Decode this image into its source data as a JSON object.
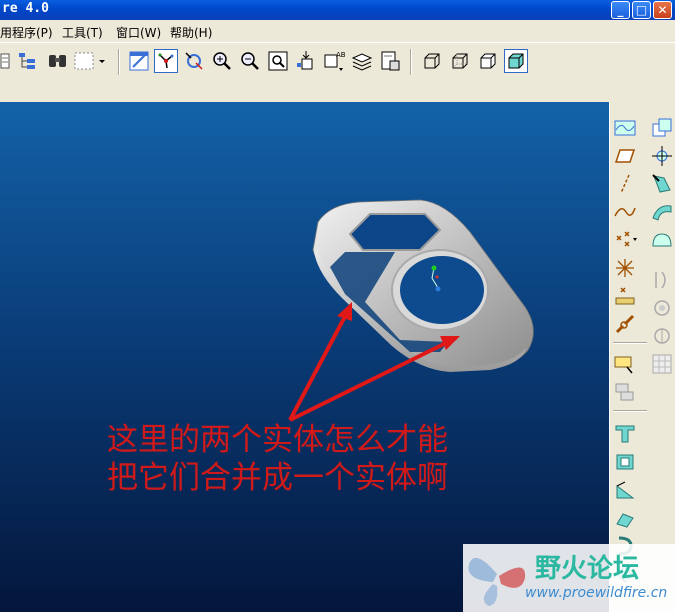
{
  "window": {
    "title": "re 4.0",
    "min_glyph": "_",
    "max_glyph": "□",
    "close_glyph": "✕"
  },
  "menu": [
    {
      "label": "用程序(P)"
    },
    {
      "label": "工具(T)"
    },
    {
      "label": "窗口(W)"
    },
    {
      "label": "帮助(H)"
    }
  ],
  "toolbar_icons": [
    "view-icon",
    "tree-icon",
    "binoculars-icon",
    "selection-box-icon",
    "dropdown-arrow-icon",
    "repaint-icon",
    "spin-center-icon",
    "orient-icon",
    "zoom-in-icon",
    "zoom-out-icon",
    "refit-icon",
    "reorient-icon",
    "saved-views-icon",
    "layers-icon",
    "view-manager-icon",
    "wireframe-icon",
    "hidden-line-icon",
    "no-hidden-icon",
    "shading-icon"
  ],
  "right_toolbar_icons": [
    "datum-plane-display-icon",
    "plane-icon",
    "axis-icon",
    "curve-icon",
    "point-icon",
    "csys-icon",
    "analysis-icon",
    "chain-icon",
    "note-icon",
    "copy-icon",
    "extrude-icon",
    "revolve-icon",
    "sweep-icon",
    "blend-icon",
    "hole-icon",
    "shell-icon",
    "rib-icon",
    "draft-icon",
    "round-icon",
    "chamfer-icon",
    "pattern-icon",
    "mirror-icon",
    "merge-icon",
    "trim-icon"
  ],
  "annotation": {
    "line1": "这里的两个实体怎么才能",
    "line2": "把它们合并成一个实体啊",
    "color": "#d01a1a"
  },
  "watermark": {
    "name": "野火论坛",
    "url": "www.proewildfire.cn"
  },
  "colors": {
    "viewport_top": "#1362a8",
    "viewport_bottom": "#04163b",
    "titlebar": "#0047c9"
  }
}
